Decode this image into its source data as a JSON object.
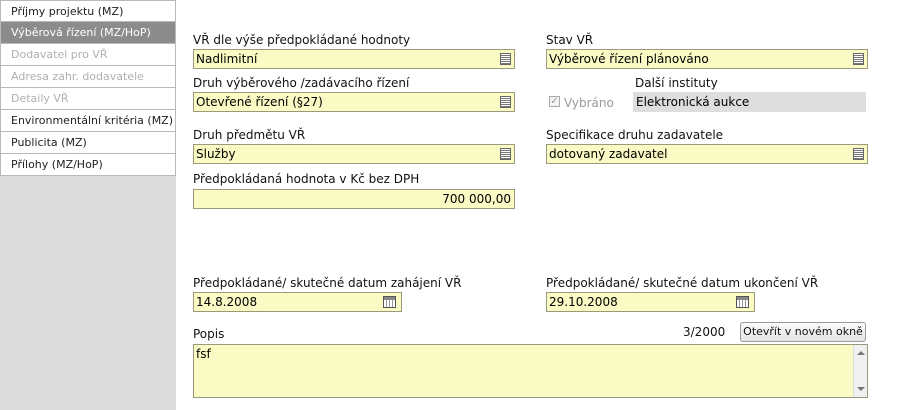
{
  "nav": {
    "items": [
      {
        "label": "Příjmy projektu (MZ)",
        "state": "normal"
      },
      {
        "label": "Výběrová řízení (MZ/HoP)",
        "state": "active"
      },
      {
        "label": "Dodavatel pro VŘ",
        "state": "disabled"
      },
      {
        "label": "Adresa zahr. dodavatele",
        "state": "disabled"
      },
      {
        "label": "Detaily VŘ",
        "state": "disabled"
      },
      {
        "label": "Environmentální kritéria (MZ)",
        "state": "normal"
      },
      {
        "label": "Publicita (MZ)",
        "state": "normal"
      },
      {
        "label": "Přílohy (MZ/HoP)",
        "state": "normal"
      }
    ]
  },
  "form": {
    "vr_label": "VŘ dle výše předpokládané hodnoty",
    "vr_value": "Nadlimitní",
    "stav_label": "Stav VŘ",
    "stav_value": "Výběrové řízení plánováno",
    "druh_rizeni_label": "Druh výběrového /zadávacího řízení",
    "druh_rizeni_value": "Otevřené řízení (§27)",
    "dalsi_instituty_label": "Další instituty",
    "vybrano_label": "Vybráno",
    "dalsi_instituty_value": "Elektronická aukce",
    "druh_predmetu_label": "Druh předmětu VŘ",
    "druh_predmetu_value": "Služby",
    "specifikace_label": "Specifikace druhu zadavatele",
    "specifikace_value": "dotovaný zadavatel",
    "hodnota_label": "Předpokládaná hodnota v Kč bez DPH",
    "hodnota_value": "700 000,00",
    "zahajeni_label": "Předpokládané/ skutečné datum zahájení VŘ",
    "zahajeni_value": "14.8.2008",
    "ukonceni_label": "Předpokládané/ skutečné datum ukončení VŘ",
    "ukonceni_value": "29.10.2008",
    "popis_label": "Popis",
    "popis_counter": "3/2000",
    "open_button": "Otevřít v novém okně",
    "popis_value": "fsf"
  },
  "colors": {
    "field_bg": "#fafac4",
    "nav_active": "#8c8c8c",
    "sidebar_bg": "#dcdcdc"
  }
}
